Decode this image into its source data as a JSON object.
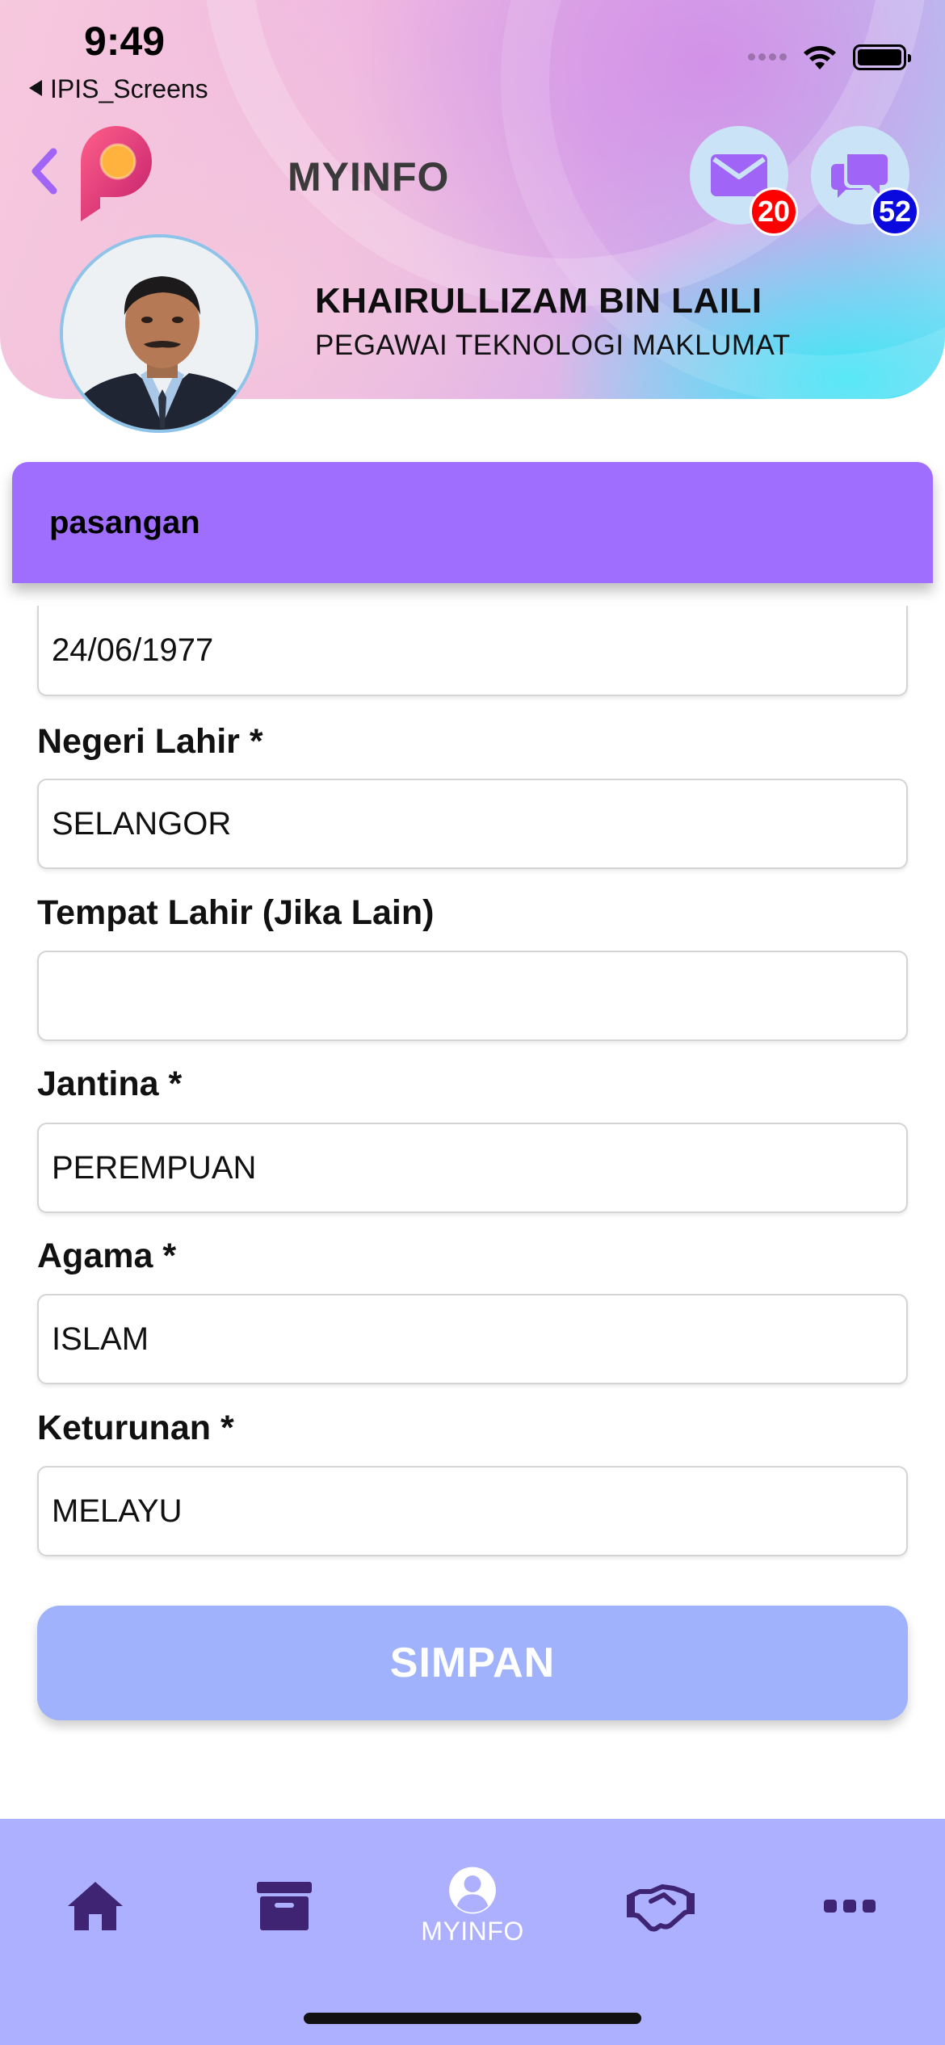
{
  "status_bar": {
    "time": "9:49",
    "back_app": "IPIS_Screens",
    "icons": [
      "signal-icon",
      "wifi-icon",
      "battery-icon"
    ]
  },
  "header": {
    "title": "MYINFO",
    "mail_badge": "20",
    "chat_badge": "52",
    "user_name": "KHAIRULLIZAM BIN LAILI",
    "user_role": "PEGAWAI TEKNOLOGI MAKLUMAT",
    "colors": {
      "mail_badge": "#ff0000",
      "chat_badge": "#0a0adf",
      "accent": "#a06efe",
      "icon_purple": "#a065f6"
    }
  },
  "section": {
    "title": "pasangan"
  },
  "form": {
    "date_value": "24/06/1977",
    "fields": [
      {
        "label": "Negeri Lahir *",
        "value": "SELANGOR"
      },
      {
        "label": "Tempat Lahir (Jika Lain)",
        "value": ""
      },
      {
        "label": "Jantina *",
        "value": "PEREMPUAN"
      },
      {
        "label": "Agama *",
        "value": "ISLAM"
      },
      {
        "label": "Keturunan *",
        "value": "MELAYU"
      }
    ],
    "save_label": "SIMPAN"
  },
  "tabbar": {
    "items": [
      {
        "icon": "home-icon",
        "label": ""
      },
      {
        "icon": "archive-icon",
        "label": ""
      },
      {
        "icon": "user-icon",
        "label": "MYINFO",
        "active": true
      },
      {
        "icon": "handshake-icon",
        "label": ""
      },
      {
        "icon": "more-icon",
        "label": ""
      }
    ],
    "colors": {
      "background": "#adb0fe",
      "icon": "#3e2473"
    }
  }
}
